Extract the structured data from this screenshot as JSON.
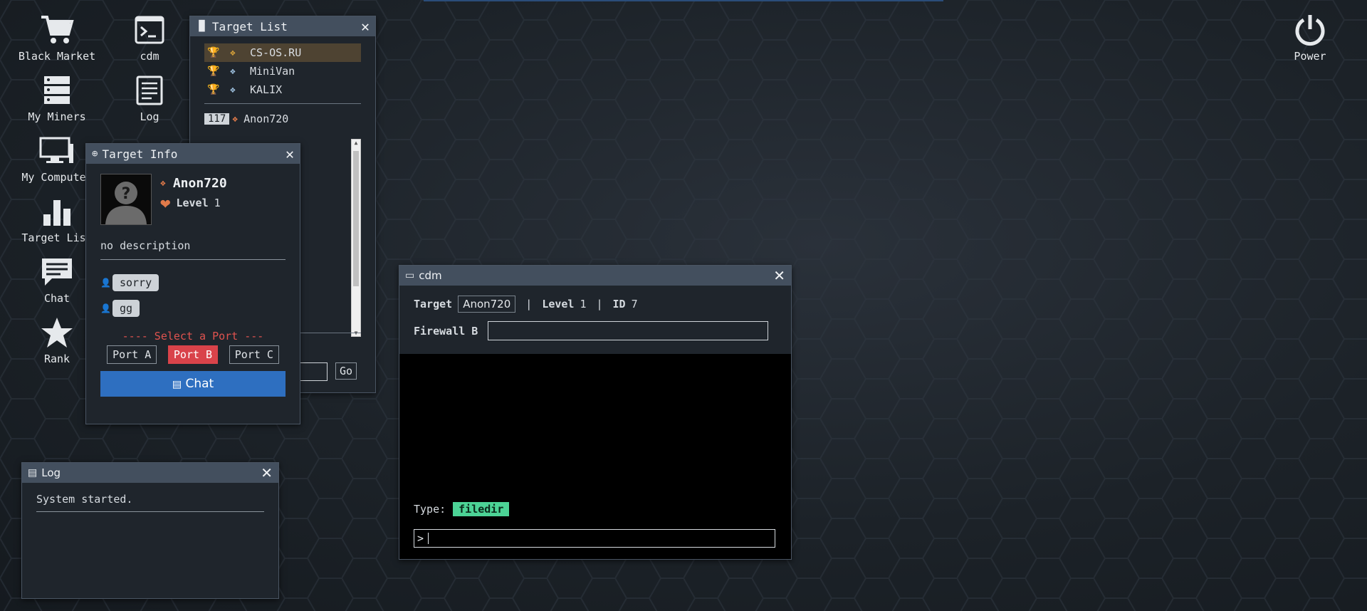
{
  "desktop": {
    "icons": [
      {
        "label": "Black Market",
        "icon": "cart-icon"
      },
      {
        "label": "cdm",
        "icon": "terminal-icon"
      },
      {
        "label": "My Miners",
        "icon": "server-icon"
      },
      {
        "label": "Log",
        "icon": "document-icon"
      },
      {
        "label": "My Computer",
        "icon": "monitor-icon"
      },
      {
        "label": "Target List",
        "icon": "bar-chart-icon"
      },
      {
        "label": "Chat",
        "icon": "chat-icon"
      },
      {
        "label": "Rank",
        "icon": "star-icon"
      },
      {
        "label": "Power",
        "icon": "power-icon"
      }
    ]
  },
  "target_list": {
    "title": "Target List",
    "top": [
      {
        "trophy": "gold",
        "name": "CS-OS.RU"
      },
      {
        "trophy": "silver",
        "name": "MiniVan"
      },
      {
        "trophy": "bronze",
        "name": "KALIX"
      }
    ],
    "players": [
      {
        "rank": "117",
        "name": "Anon720"
      }
    ],
    "go_label": "Go"
  },
  "target_info": {
    "title": "Target Info",
    "name": "Anon720",
    "level_label": "Level",
    "level": "1",
    "description": "no description",
    "messages": [
      "sorry",
      "gg"
    ],
    "port_prompt": "---- Select a Port ---",
    "ports": [
      "Port A",
      "Port B",
      "Port C"
    ],
    "active_port": "Port B",
    "chat_label": "Chat"
  },
  "cdm": {
    "title": "cdm",
    "target_label": "Target",
    "target_value": "Anon720",
    "sep": "|",
    "level_label": "Level",
    "level_value": "1",
    "id_label": "ID",
    "id_value": "7",
    "firewall_label": "Firewall B",
    "type_label": "Type:",
    "type_value": "filedir",
    "prompt": ">"
  },
  "log": {
    "title": "Log",
    "entries": [
      "System started."
    ]
  },
  "colors": {
    "accent_blue": "#2e6fc0",
    "port_active": "#d9434a",
    "type_tag": "#4cd396",
    "window_title": "#434f5e"
  }
}
